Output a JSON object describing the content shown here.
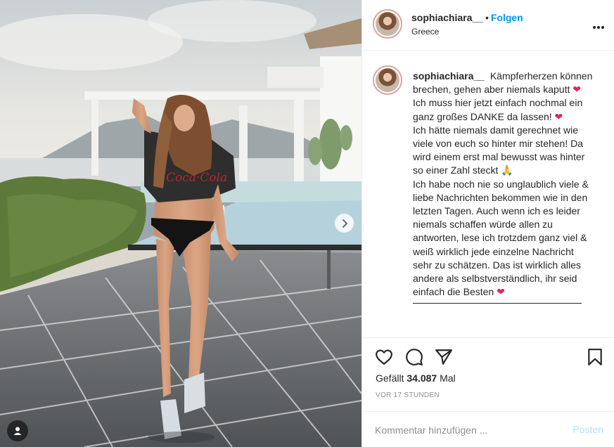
{
  "post": {
    "username": "sophiachiara__",
    "separator": "•",
    "follow_label": "Folgen",
    "location": "Greece",
    "more_icon": "more-horizontal-icon"
  },
  "caption": {
    "username": "sophiachiara__",
    "line1": "Kämpferherzen können brechen, gehen aber niemals kaputt",
    "line2": "Ich muss hier jetzt einfach nochmal ein ganz großes DANKE da lassen!",
    "line3": "Ich hätte niemals damit gerechnet wie viele von euch so hinter mir stehen! Da wird einem erst mal bewusst was hinter so einer Zahl steckt",
    "line4": "Ich habe noch nie so unglaublich viele & liebe Nachrichten bekommen wie in den letzten Tagen. Auch wenn ich es leider niemals schaffen würde allen zu antworten, lese ich trotzdem ganz viel & weiß wirklich jede einzelne Nachricht sehr zu schätzen. Das ist wirklich alles andere als selbstverständlich, ihr seid einfach die Besten",
    "heart_emoji": "❤",
    "pray_emoji": "🙏",
    "heart_color": "#e0245e"
  },
  "actions": {
    "like_icon": "heart-outline-icon",
    "comment_icon": "comment-bubble-icon",
    "share_icon": "paper-plane-icon",
    "save_icon": "bookmark-icon"
  },
  "stats": {
    "likes_prefix": "Gefällt ",
    "likes_count": "34.087",
    "likes_suffix": " Mal",
    "time_ago": "VOR 17 STUNDEN"
  },
  "comment": {
    "placeholder": "Kommentar hinzufügen ...",
    "post_label": "Posten"
  },
  "colors": {
    "follow": "#0095f6",
    "post_disabled": "#b2dffc",
    "text": "#262626",
    "muted": "#8e8e8e"
  }
}
